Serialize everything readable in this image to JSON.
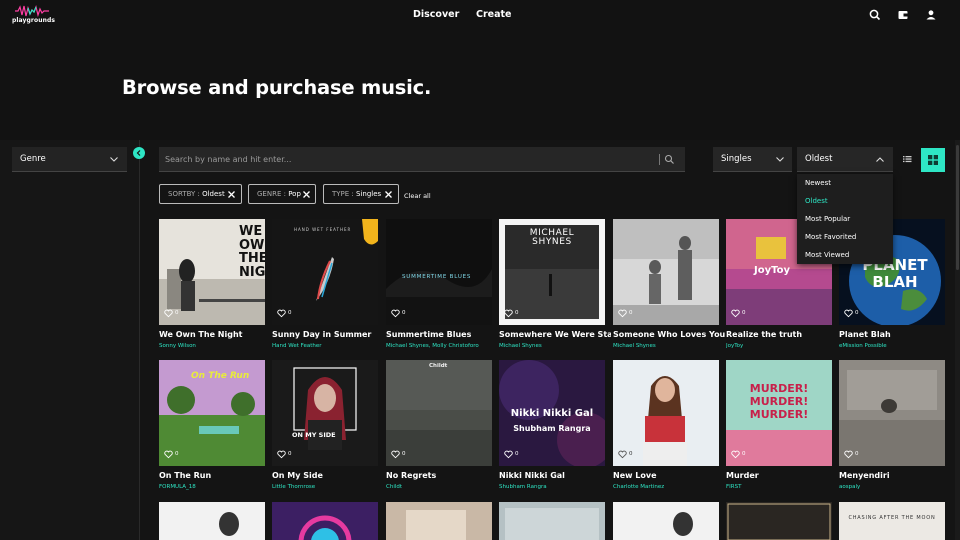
{
  "app": {
    "logo_text": "playgrounds"
  },
  "nav": {
    "discover": "Discover",
    "create": "Create"
  },
  "hero": {
    "title": "Browse and purchase music."
  },
  "filters": {
    "genre_label": "Genre",
    "search_placeholder": "Search by name and hit enter...",
    "type_value": "Singles",
    "sort_value": "Oldest",
    "sort_options": [
      "Newest",
      "Oldest",
      "Most Popular",
      "Most Favorited",
      "Most Viewed"
    ],
    "active_sort_option": "Oldest",
    "chips": [
      {
        "key": "SORTBY",
        "value": "Oldest"
      },
      {
        "key": "GENRE",
        "value": "Pop"
      },
      {
        "key": "TYPE",
        "value": "Singles"
      }
    ],
    "clear_all": "Clear all"
  },
  "colors": {
    "accent": "#2ee6c5",
    "background": "#141414",
    "panel": "#262626"
  },
  "icons": [
    "search-icon",
    "wallet-icon",
    "user-icon",
    "chevron-down-icon",
    "chevron-up-icon",
    "chevron-left-icon",
    "close-icon",
    "list-view-icon",
    "grid-view-icon",
    "heart-icon"
  ],
  "tracks_row1": [
    {
      "title": "We Own The Night",
      "artist": "Sonny Wilson",
      "likes": "0",
      "cover_text": "WE OWN THE NIGHT"
    },
    {
      "title": "Sunny Day in Summer",
      "artist": "Hand Wet Feather",
      "likes": "0",
      "cover_text": "HAND WET FEATHER"
    },
    {
      "title": "Summertime Blues",
      "artist": "Michael Shynes, Molly Christoforo",
      "likes": "0",
      "cover_text": "SUMMERTIME BLUES"
    },
    {
      "title": "Somewhere We Were Stars",
      "artist": "Michael Shynes",
      "likes": "0",
      "cover_text": "MICHAEL SHYNES"
    },
    {
      "title": "Someone Who Loves You",
      "artist": "Michael Shynes",
      "likes": "0",
      "cover_text": ""
    },
    {
      "title": "Realize the truth",
      "artist": "JoyToy",
      "likes": "0",
      "cover_text": "JoyToy"
    },
    {
      "title": "Planet Blah",
      "artist": "eMission Possible",
      "likes": "0",
      "cover_text": "PLANET BLAH"
    }
  ],
  "tracks_row2": [
    {
      "title": "On The Run",
      "artist": "FORMULA_18",
      "likes": "0",
      "cover_text": "On The Run"
    },
    {
      "title": "On My Side",
      "artist": "Little Thornrose",
      "likes": "0",
      "cover_text": "ON MY SIDE"
    },
    {
      "title": "No Regrets",
      "artist": "Childt",
      "likes": "0",
      "cover_text": "Childt"
    },
    {
      "title": "Nikki Nikki Gal",
      "artist": "Shubham Rangra",
      "likes": "0",
      "cover_text": "Nikki Nikki Gal"
    },
    {
      "title": "New Love",
      "artist": "Charlotte Martinez",
      "likes": "0",
      "cover_text": ""
    },
    {
      "title": "Murder",
      "artist": "FIRST",
      "likes": "0",
      "cover_text": "MURDER! MURDER! MURDER!"
    },
    {
      "title": "Menyendiri",
      "artist": "aospaly",
      "likes": "0",
      "cover_text": ""
    }
  ],
  "tracks_row3_partial_cover_text": "CHASING AFTER THE MOON"
}
